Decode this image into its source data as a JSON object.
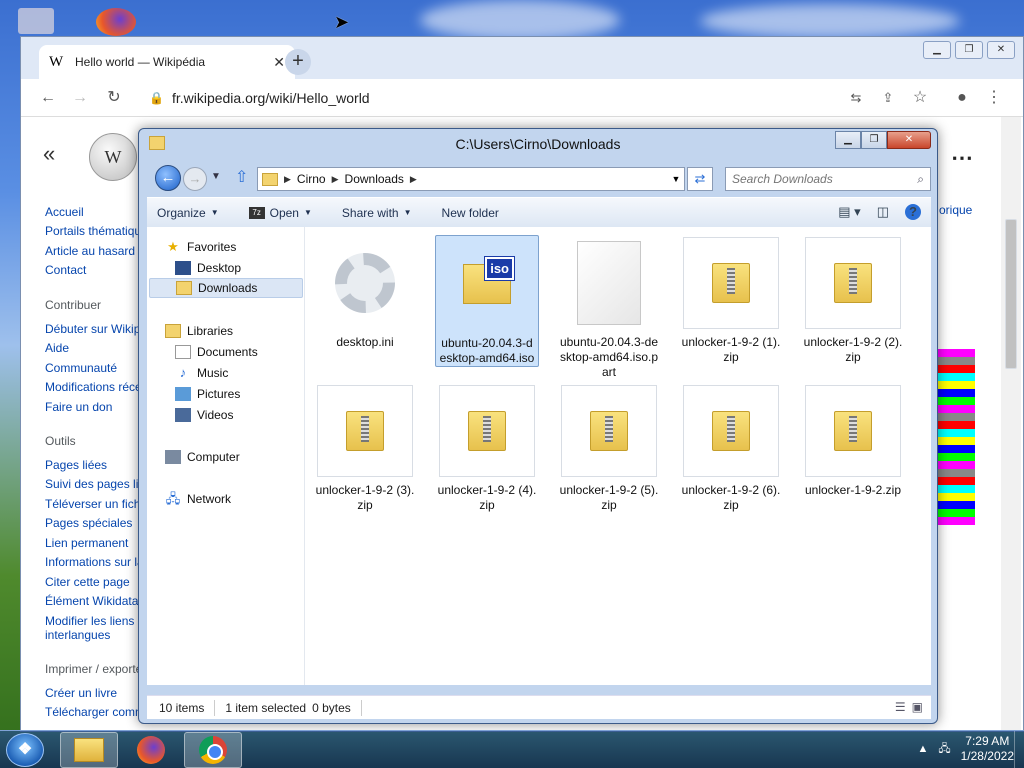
{
  "chrome": {
    "tab_title": "Hello world — Wikipédia",
    "tab_favicon": "W",
    "url": "fr.wikipedia.org/wiki/Hello_world"
  },
  "wiki_sidebar": {
    "nav": [
      "Accueil",
      "Portails thématiques",
      "Article au hasard",
      "Contact"
    ],
    "contribute_heading": "Contribuer",
    "contribute": [
      "Débuter sur Wikipédia",
      "Aide",
      "Communauté",
      "Modifications récentes",
      "Faire un don"
    ],
    "tools_heading": "Outils",
    "tools": [
      "Pages liées",
      "Suivi des pages liées",
      "Téléverser un fichier",
      "Pages spéciales",
      "Lien permanent",
      "Informations sur la page",
      "Citer cette page",
      "Élément Wikidata",
      "Modifier les liens interlangues"
    ],
    "print_heading": "Imprimer / exporter",
    "print": [
      "Créer un livre",
      "Télécharger comme PDF"
    ],
    "right_fragment": "orique"
  },
  "explorer": {
    "title": "C:\\Users\\Cirno\\Downloads",
    "breadcrumb": [
      "Cirno",
      "Downloads"
    ],
    "search_placeholder": "Search Downloads",
    "commands": {
      "organize": "Organize",
      "open": "Open",
      "share": "Share with",
      "new_folder": "New folder"
    },
    "nav": {
      "favorites": "Favorites",
      "desktop": "Desktop",
      "downloads": "Downloads",
      "libraries": "Libraries",
      "documents": "Documents",
      "music": "Music",
      "pictures": "Pictures",
      "videos": "Videos",
      "computer": "Computer",
      "network": "Network"
    },
    "files": [
      {
        "name": "desktop.ini",
        "icon": "settings-file-icon"
      },
      {
        "name": "ubuntu-20.04.3-desktop-amd64.iso",
        "icon": "iso-icon",
        "selected": true
      },
      {
        "name": "ubuntu-20.04.3-desktop-amd64.iso.part",
        "icon": "blank-file-icon"
      },
      {
        "name": "unlocker-1-9-2 (1).zip",
        "icon": "zip-icon"
      },
      {
        "name": "unlocker-1-9-2 (2).zip",
        "icon": "zip-icon"
      },
      {
        "name": "unlocker-1-9-2 (3).zip",
        "icon": "zip-icon"
      },
      {
        "name": "unlocker-1-9-2 (4).zip",
        "icon": "zip-icon"
      },
      {
        "name": "unlocker-1-9-2 (5).zip",
        "icon": "zip-icon"
      },
      {
        "name": "unlocker-1-9-2 (6).zip",
        "icon": "zip-icon"
      },
      {
        "name": "unlocker-1-9-2.zip",
        "icon": "zip-icon"
      }
    ],
    "status": {
      "count": "10 items",
      "selected": "1 item selected",
      "size": "0 bytes"
    }
  },
  "taskbar": {
    "time": "7:29 AM",
    "date": "1/28/2022"
  },
  "colors": {
    "selection": "#cde3fb",
    "link": "#0645ad",
    "explorer_frame": "#c2d5ee"
  }
}
